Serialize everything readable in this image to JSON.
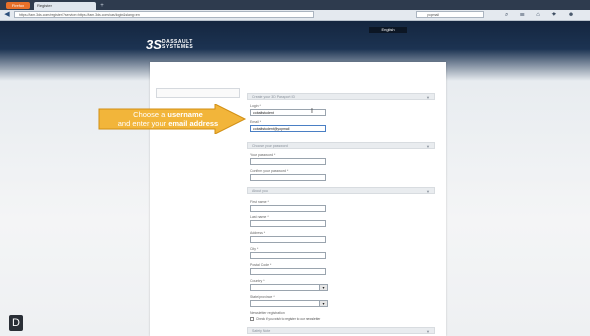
{
  "browser": {
    "firefox_tab": "Firefox",
    "active_tab": "Register",
    "new_tab": "+",
    "window_buttons": [
      "–",
      "□",
      "✕"
    ],
    "back": "◀",
    "url": "https://iam.3ds.com/register/?service=https://iam.3ds.com/cas/login&slang=en",
    "search_placeholder": "yopmail",
    "nav_icons": "⌕ ☰ ⌂ ✦ ☻"
  },
  "header": {
    "language_button": "English",
    "logo_mark": "3S",
    "logo_line1": "DASSAULT",
    "logo_line2": "SYSTEMES"
  },
  "form": {
    "section_create": "Create your 3D Passport ID",
    "username_label": "Login *",
    "username_value": "cobaltstudent",
    "email_label": "Email *",
    "email_value": "cobaltstudent@yopmail",
    "section_password": "Choose your password",
    "password_label": "Your password *",
    "confirm_password_label": "Confirm your password *",
    "section_about": "About you",
    "first_name_label": "First name *",
    "last_name_label": "Last name *",
    "address_label": "Address *",
    "city_label": "City *",
    "postal_code_label": "Postal Code *",
    "country_label": "Country *",
    "state_label": "State/province *",
    "newsletter_label": "Newsletter registration",
    "newsletter_text": "Check if you wish to register to our newsletter",
    "section_last": "Safety Note"
  },
  "callout": {
    "line1_prefix": "Choose a ",
    "line1_bold": "username",
    "line2_prefix": "and enter your ",
    "line2_bold": "email address"
  },
  "badge": "D",
  "colors": {
    "callout_fill": "#f2b53a",
    "callout_edge": "#d18f14",
    "header_dark": "#14263f"
  }
}
